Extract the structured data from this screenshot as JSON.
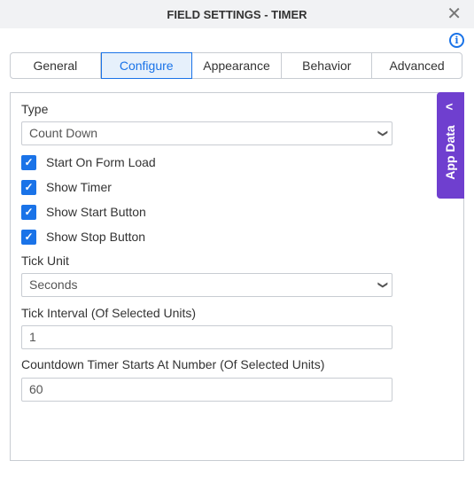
{
  "title": "FIELD SETTINGS - TIMER",
  "tabs": [
    "General",
    "Configure",
    "Appearance",
    "Behavior",
    "Advanced"
  ],
  "active_tab": "Configure",
  "app_data_label": "App Data",
  "type": {
    "label": "Type",
    "value": "Count Down"
  },
  "checkboxes": [
    {
      "label": "Start On Form Load",
      "checked": true
    },
    {
      "label": "Show Timer",
      "checked": true
    },
    {
      "label": "Show Start Button",
      "checked": true
    },
    {
      "label": "Show Stop Button",
      "checked": true
    }
  ],
  "tick_unit": {
    "label": "Tick Unit",
    "value": "Seconds"
  },
  "tick_interval": {
    "label": "Tick Interval (Of Selected Units)",
    "value": "1"
  },
  "countdown_start": {
    "label": "Countdown Timer Starts At Number (Of Selected Units)",
    "value": "60"
  },
  "colors": {
    "accent": "#1a73e8",
    "app_data": "#6f3fcf"
  }
}
